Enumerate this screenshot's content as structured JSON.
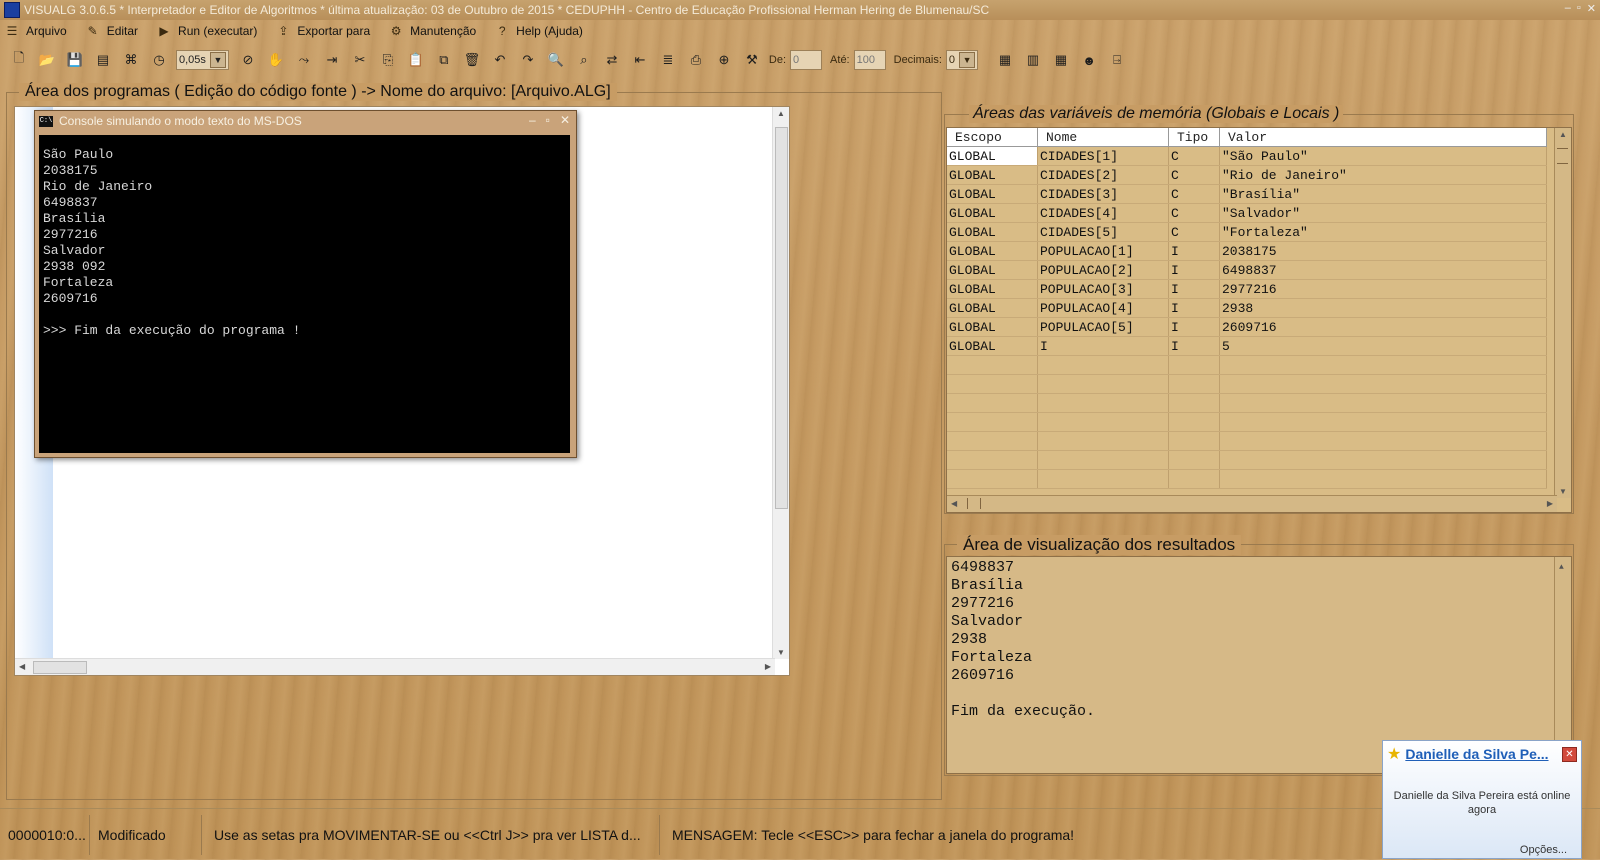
{
  "window": {
    "title": "VISUALG 3.0.6.5 * Interpretador e Editor de Algoritmos * última atualização: 03 de Outubro de 2015 * CEDUPHH - Centro de Educação Profissional Herman Hering de Blumenau/SC"
  },
  "menu": [
    {
      "label": "Arquivo",
      "icon": "folder-icon",
      "glyph": "☰"
    },
    {
      "label": "Editar",
      "icon": "edit-icon",
      "glyph": "✎"
    },
    {
      "label": "Run (executar)",
      "icon": "run-icon",
      "glyph": "🏃"
    },
    {
      "label": "Exportar para",
      "icon": "export-icon",
      "glyph": "⇪"
    },
    {
      "label": "Manutenção",
      "icon": "maintenance-icon",
      "glyph": "⚙"
    },
    {
      "label": "Help (Ajuda)",
      "icon": "help-icon",
      "glyph": "?"
    }
  ],
  "toolbar": {
    "speed_value": "0,05s",
    "de_label": "De:",
    "de_value": "0",
    "ate_label": "Até:",
    "ate_value": "100",
    "decimais_label": "Decimais:",
    "decimais_value": "0"
  },
  "program_area": {
    "legend": "Área dos programas ( Edição do código fonte ) -> Nome do arquivo: [Arquivo.ALG]"
  },
  "console": {
    "title": "Console simulando o modo texto do MS-DOS",
    "output": "São Paulo\n2038175\nRio de Janeiro\n6498837\nBrasília\n2977216\nSalvador\n2938 092\nFortaleza\n2609716\n\n>>> Fim da execução do programa !"
  },
  "variables": {
    "legend": "Áreas das variáveis de memória (Globais e Locais )",
    "columns": [
      "Escopo",
      "Nome",
      "Tipo",
      "Valor"
    ],
    "rows": [
      [
        "GLOBAL",
        "CIDADES[1]",
        "C",
        "\"São Paulo\""
      ],
      [
        "GLOBAL",
        "CIDADES[2]",
        "C",
        "\"Rio de Janeiro\""
      ],
      [
        "GLOBAL",
        "CIDADES[3]",
        "C",
        "\"Brasília\""
      ],
      [
        "GLOBAL",
        "CIDADES[4]",
        "C",
        "\"Salvador\""
      ],
      [
        "GLOBAL",
        "CIDADES[5]",
        "C",
        "\"Fortaleza\""
      ],
      [
        "GLOBAL",
        "POPULACAO[1]",
        "I",
        "2038175"
      ],
      [
        "GLOBAL",
        "POPULACAO[2]",
        "I",
        "6498837"
      ],
      [
        "GLOBAL",
        "POPULACAO[3]",
        "I",
        "2977216"
      ],
      [
        "GLOBAL",
        "POPULACAO[4]",
        "I",
        "2938"
      ],
      [
        "GLOBAL",
        "POPULACAO[5]",
        "I",
        "2609716"
      ],
      [
        "GLOBAL",
        "I",
        "I",
        "5"
      ]
    ]
  },
  "results": {
    "legend": "Área de visualização dos resultados",
    "text": "6498837\nBrasília\n2977216\nSalvador\n2938\nFortaleza\n2609716\n\nFim da execução."
  },
  "statusbar": {
    "position": "0000010:0...",
    "state": "Modificado",
    "hint": "Use as setas pra MOVIMENTAR-SE ou <<Ctrl J>> pra ver LISTA d...",
    "message": "MENSAGEM: Tecle <<ESC>> para fechar a janela do programa!"
  },
  "notification": {
    "name": "Danielle da Silva Pe...",
    "message": "Danielle da Silva Pereira está online agora",
    "options": "Opções..."
  }
}
